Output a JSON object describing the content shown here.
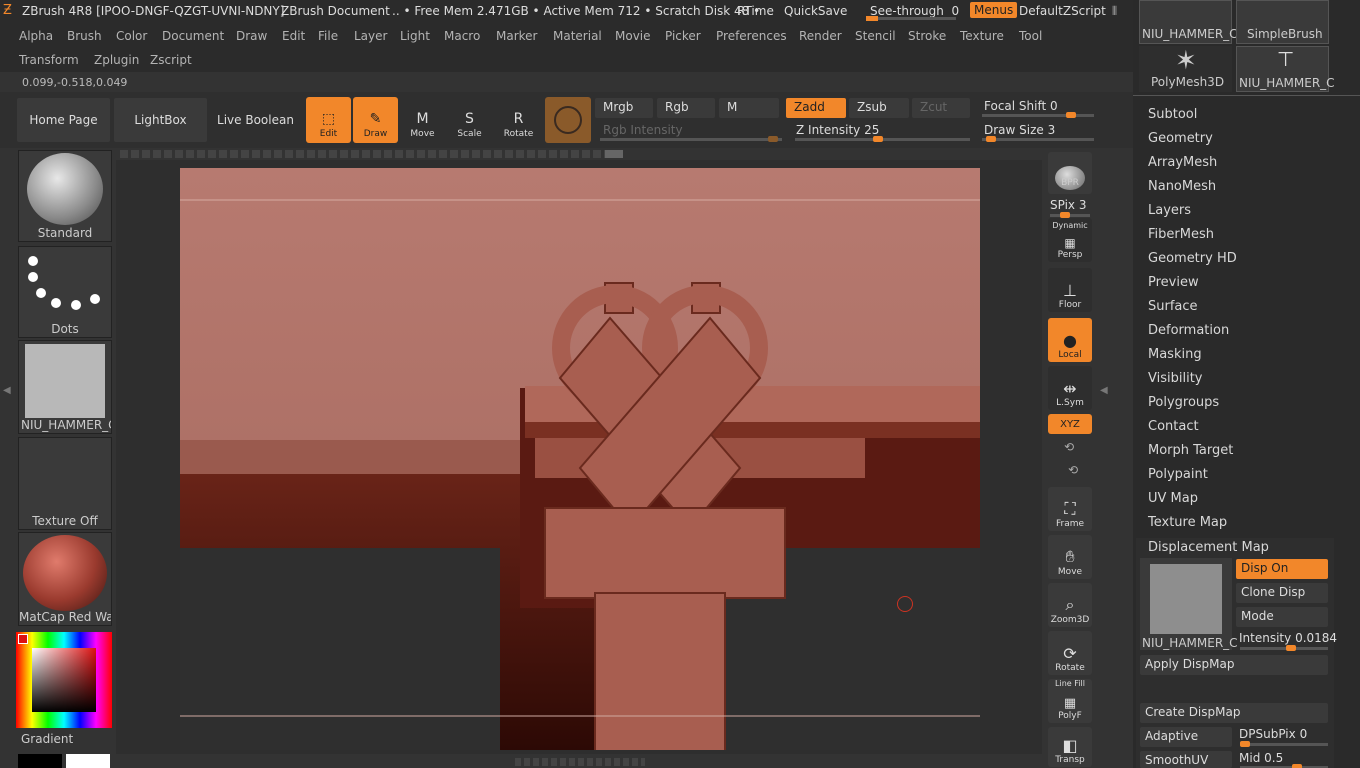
{
  "titlebar": {
    "app": "ZBrush 4R8 [IPOO-DNGF-QZGT-UVNI-NDNY]",
    "document": "ZBrush Document",
    "mem": ".. • Free Mem 2.471GB • Active Mem 712 • Scratch Disk 48 •",
    "rtime": "RTime",
    "quicksave": "QuickSave",
    "see_through": "See-through",
    "see_through_value": "0",
    "menus": "Menus",
    "script": "DefaultZScript"
  },
  "menus_row1": [
    "Alpha",
    "Brush",
    "Color",
    "Document",
    "Draw",
    "Edit",
    "File",
    "Layer",
    "Light",
    "Macro",
    "Marker",
    "Material",
    "Movie",
    "Picker",
    "Preferences",
    "Render",
    "Stencil",
    "Stroke",
    "Texture",
    "Tool"
  ],
  "menus_row2": [
    "Transform",
    "Zplugin",
    "Zscript"
  ],
  "coords": "0.099,-0.518,0.049",
  "nav": {
    "home": "Home Page",
    "lightbox": "LightBox",
    "boolean": "Live Boolean"
  },
  "tools": [
    {
      "label": "Edit",
      "glyph": "⬚",
      "on": true
    },
    {
      "label": "Draw",
      "glyph": "✎",
      "on": true
    },
    {
      "label": "Move",
      "glyph": "M",
      "on": false
    },
    {
      "label": "Scale",
      "glyph": "S",
      "on": false
    },
    {
      "label": "Rotate",
      "glyph": "R",
      "on": false
    }
  ],
  "color_modes": {
    "mrgb": "Mrgb",
    "rgb": "Rgb",
    "m": "M",
    "rgb_intensity": "Rgb Intensity"
  },
  "z_modes": {
    "zadd": "Zadd",
    "zsub": "Zsub",
    "zcut": "Zcut",
    "z_intensity_label": "Z Intensity",
    "z_intensity": "25"
  },
  "focal": {
    "label": "Focal Shift",
    "value": "0"
  },
  "draw_size": {
    "label": "Draw Size",
    "value": "3"
  },
  "left_shelf": {
    "brush": "Standard",
    "stroke": "Dots",
    "alpha": "NIU_HAMMER_C",
    "texture": "Texture Off",
    "material": "MatCap Red Wax",
    "gradient": "Gradient"
  },
  "right_shelf": {
    "bpr": "BPR",
    "spix_label": "SPix",
    "spix": "3",
    "persp": "Persp",
    "dynamic": "Dynamic",
    "floor": "Floor",
    "local": "Local",
    "lsym": "L.Sym",
    "xyz": "XYZ",
    "frame": "Frame",
    "move": "Move",
    "zoom": "Zoom3D",
    "rotate": "Rotate",
    "linefill": "Line Fill",
    "polyf": "PolyF",
    "transp": "Transp"
  },
  "tool_thumbs": {
    "t1": "NIU_HAMMER_C",
    "t2": "SimpleBrush",
    "t3": "PolyMesh3D",
    "t4": "NIU_HAMMER_C"
  },
  "tool_panel": [
    "Subtool",
    "Geometry",
    "ArrayMesh",
    "NanoMesh",
    "Layers",
    "FiberMesh",
    "Geometry HD",
    "Preview",
    "Surface",
    "Deformation",
    "Masking",
    "Visibility",
    "Polygroups",
    "Contact",
    "Morph Target",
    "Polypaint",
    "UV Map",
    "Texture Map"
  ],
  "displacement": {
    "header": "Displacement Map",
    "thumb": "NIU_HAMMER_C",
    "disp_on": "Disp On",
    "clone": "Clone Disp",
    "mode": "Mode",
    "intensity_label": "Intensity",
    "intensity": "0.0184",
    "apply": "Apply DispMap",
    "create": "Create DispMap",
    "adaptive": "Adaptive",
    "dpsubpix_label": "DPSubPix",
    "dpsubpix": "0",
    "smoothuv": "SmoothUV",
    "mid_label": "Mid",
    "mid": "0.5"
  },
  "colors": {
    "accent": "#f2872a",
    "mesh": "#a25a4c",
    "panel": "#2a2a2a"
  }
}
